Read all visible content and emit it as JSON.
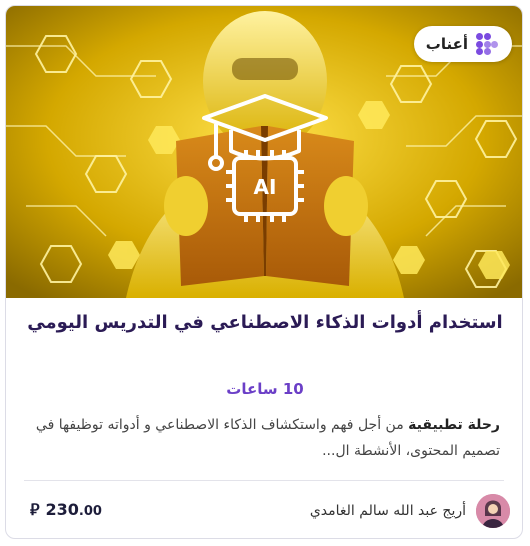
{
  "badge": {
    "label": "أعناب",
    "logo_color": "#7b4be0"
  },
  "hero": {
    "chip_text": "AI",
    "palette": {
      "bg": "#c9a100",
      "accent": "#ffd400",
      "hex": "#ffe34d"
    }
  },
  "course": {
    "title": "استخدام أدوات الذكاء الاصطناعي في التدريس اليومي",
    "duration": "10 ساعات",
    "description_bold": "رحلة تطبيقية",
    "description_rest": " من أجل فهم واستكشاف الذكاء الاصطناعي و أدواته توظيفها في تصميم المحتوى، الأنشطة ال...",
    "instructor": "أريج عبد الله سالم الغامدي",
    "price_whole": "230",
    "price_decimal": ".00",
    "currency_symbol": "⃁"
  }
}
